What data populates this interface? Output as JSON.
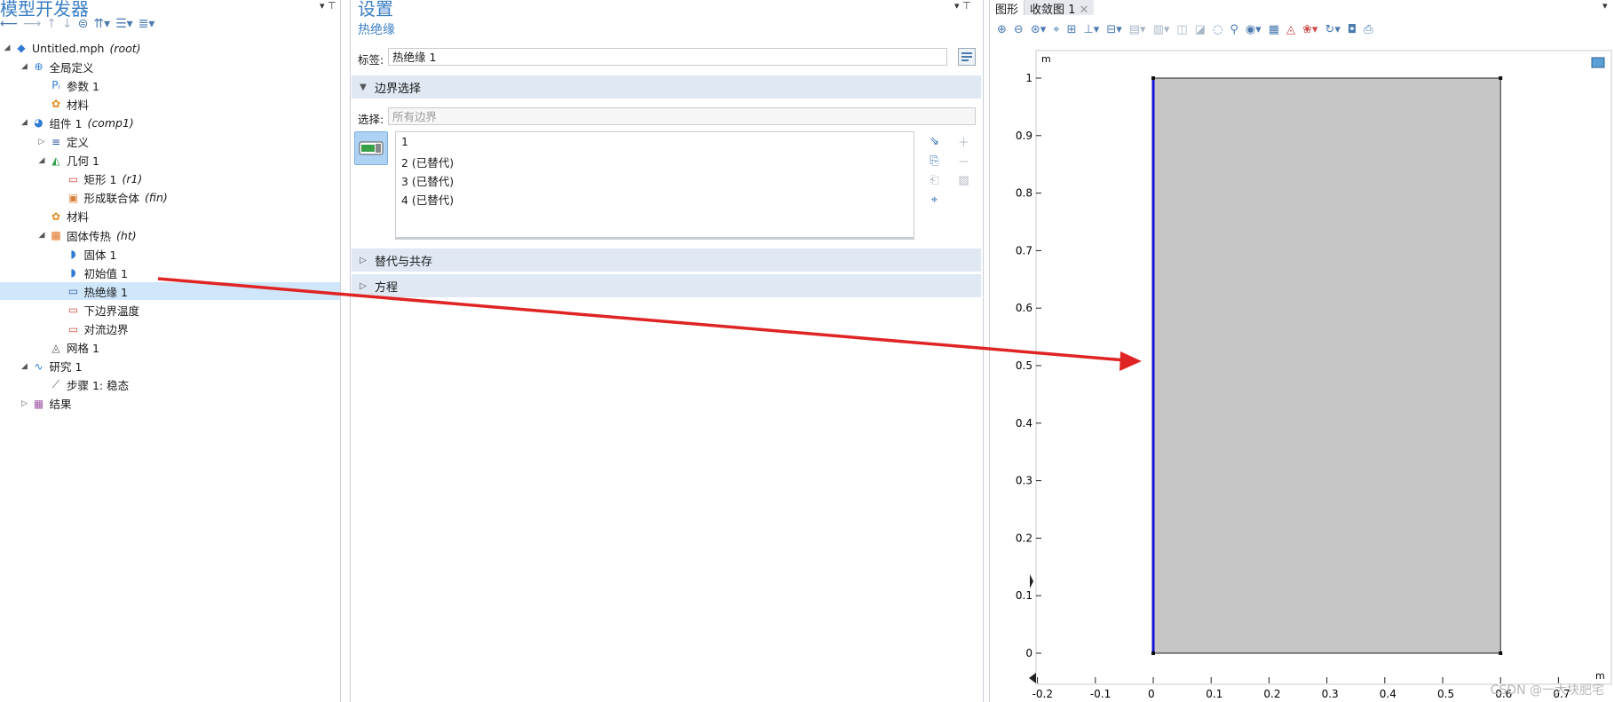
{
  "model_builder": {
    "title": "模型开发器",
    "tree": [
      {
        "label": "Untitled.mph",
        "sub": "(root)",
        "icon": "app-icon",
        "level": 0,
        "toggle": "open"
      },
      {
        "label": "全局定义",
        "sub": "",
        "icon": "globe-icon",
        "level": 1,
        "toggle": "open"
      },
      {
        "label": "参数 1",
        "sub": "",
        "icon": "parameter-icon",
        "level": 2,
        "toggle": ""
      },
      {
        "label": "材料",
        "sub": "",
        "icon": "material-icon",
        "level": 2,
        "toggle": ""
      },
      {
        "label": "组件 1",
        "sub": "(comp1)",
        "icon": "component-icon",
        "level": 1,
        "toggle": "open"
      },
      {
        "label": "定义",
        "sub": "",
        "icon": "definitions-icon",
        "level": 2,
        "toggle": "closed"
      },
      {
        "label": "几何 1",
        "sub": "",
        "icon": "geometry-icon",
        "level": 2,
        "toggle": "open"
      },
      {
        "label": "矩形 1",
        "sub": "(r1)",
        "icon": "rectangle-icon",
        "level": 3,
        "toggle": ""
      },
      {
        "label": "形成联合体",
        "sub": "(fin)",
        "icon": "form-union-icon",
        "level": 3,
        "toggle": ""
      },
      {
        "label": "材料",
        "sub": "",
        "icon": "material-icon",
        "level": 2,
        "toggle": ""
      },
      {
        "label": "固体传热",
        "sub": "(ht)",
        "icon": "heat-transfer-icon",
        "level": 2,
        "toggle": "open"
      },
      {
        "label": "固体 1",
        "sub": "",
        "icon": "solid-icon",
        "level": 3,
        "toggle": ""
      },
      {
        "label": "初始值 1",
        "sub": "",
        "icon": "initial-values-icon",
        "level": 3,
        "toggle": ""
      },
      {
        "label": "热绝缘 1",
        "sub": "",
        "icon": "thermal-insulation-icon",
        "level": 3,
        "toggle": "",
        "selected": true
      },
      {
        "label": "下边界温度",
        "sub": "",
        "icon": "temperature-icon",
        "level": 3,
        "toggle": ""
      },
      {
        "label": "对流边界",
        "sub": "",
        "icon": "convection-icon",
        "level": 3,
        "toggle": ""
      },
      {
        "label": "网格 1",
        "sub": "",
        "icon": "mesh-icon",
        "level": 2,
        "toggle": ""
      },
      {
        "label": "研究 1",
        "sub": "",
        "icon": "study-icon",
        "level": 1,
        "toggle": "open"
      },
      {
        "label": "步骤 1: 稳态",
        "sub": "",
        "icon": "step-icon",
        "level": 2,
        "toggle": ""
      },
      {
        "label": "结果",
        "sub": "",
        "icon": "results-icon",
        "level": 1,
        "toggle": "closed"
      }
    ]
  },
  "settings": {
    "title": "设置",
    "subtitle": "热绝缘",
    "label_caption": "标签:",
    "label_value": "热绝缘 1",
    "boundary_section": "边界选择",
    "selection_caption": "选择:",
    "selection_value": "所有边界",
    "boundaries": [
      "1",
      "2 (已替代)",
      "3 (已替代)",
      "4 (已替代)"
    ],
    "override_section": "替代与共存",
    "equation_section": "方程"
  },
  "graphics": {
    "tabs": [
      "图形",
      "收敛图 1"
    ],
    "unit_label": "m",
    "x_ticks": [
      "-0.2",
      "-0.1",
      "0",
      "0.1",
      "0.2",
      "0.3",
      "0.4",
      "0.5",
      "0.6",
      "0.7"
    ],
    "y_ticks": [
      "0",
      "0.1",
      "0.2",
      "0.3",
      "0.4",
      "0.5",
      "0.6",
      "0.7",
      "0.8",
      "0.9",
      "1"
    ],
    "geometry_fill": "#c6c6c6",
    "highlight_edge_color": "#1414d8",
    "arrow_color": "#e02424",
    "watermark": "CSDN @一大块肥宅"
  }
}
